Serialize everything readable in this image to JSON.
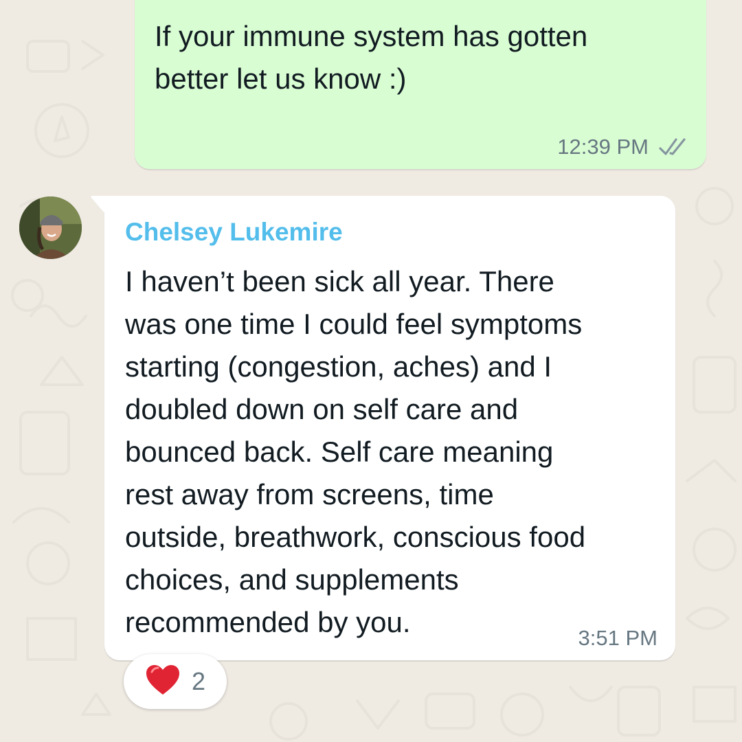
{
  "colors": {
    "wallpaper": "#efeae2",
    "outgoing_bubble": "#d9fdd3",
    "incoming_bubble": "#ffffff",
    "sender_name": "#53bdeb",
    "meta_text": "#667781",
    "reaction_heart": "#e02434"
  },
  "outgoing_message": {
    "text": "If your immune system has gotten\nbetter let us know :)",
    "time": "12:39 PM",
    "status_icon": "double-check-icon"
  },
  "incoming_message": {
    "sender": "Chelsey Lukemire",
    "avatar_icon": "avatar-photo",
    "text": "I haven’t been sick all year. There\nwas one time I could feel symptoms\nstarting (congestion, aches) and I\ndoubled down on self care and\nbounced back. Self care meaning\nrest away from screens, time\noutside, breathwork, conscious food\nchoices, and supplements\nrecommended by you.",
    "time": "3:51 PM"
  },
  "reaction": {
    "icon": "red-heart-icon",
    "count": "2"
  }
}
